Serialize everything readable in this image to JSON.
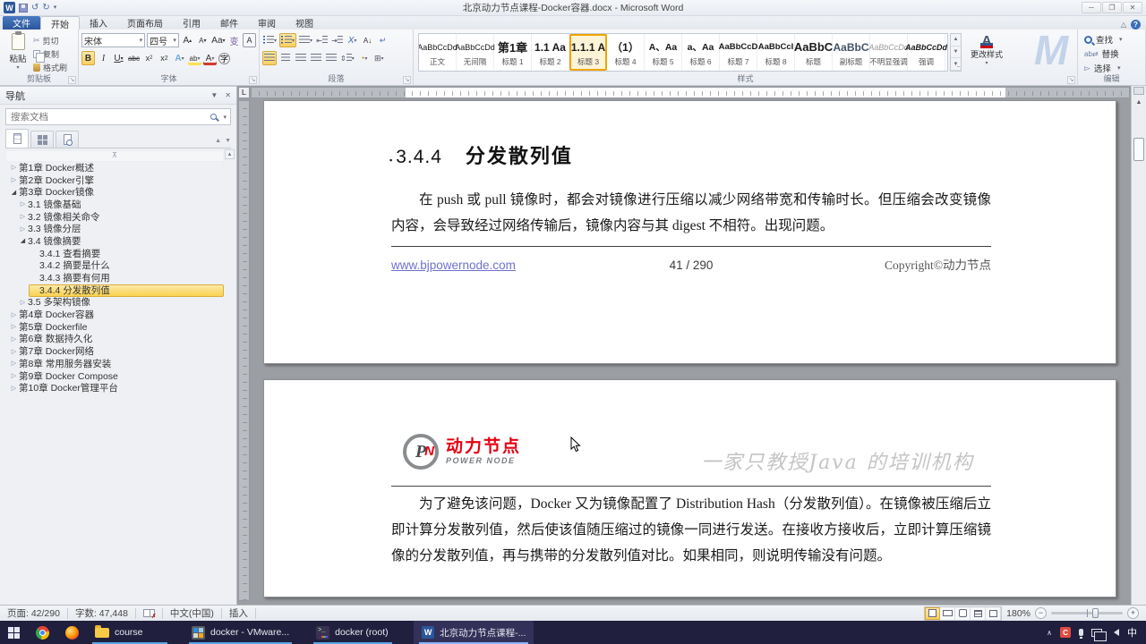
{
  "window": {
    "title": "北京动力节点课程-Docker容器.docx - Microsoft Word"
  },
  "ribbon": {
    "tabs": [
      {
        "label": "文件"
      },
      {
        "label": "开始"
      },
      {
        "label": "插入"
      },
      {
        "label": "页面布局"
      },
      {
        "label": "引用"
      },
      {
        "label": "邮件"
      },
      {
        "label": "审阅"
      },
      {
        "label": "视图"
      }
    ],
    "clipboard": {
      "label": "剪贴板",
      "paste": "粘贴",
      "cut": "剪切",
      "copy": "复制",
      "format_painter": "格式刷"
    },
    "font": {
      "label": "字体",
      "family": "宋体",
      "size": "四号"
    },
    "paragraph": {
      "label": "段落"
    },
    "styles": {
      "label": "样式",
      "change": "更改样式",
      "items": [
        {
          "preview": "AaBbCcDd",
          "name": "正文"
        },
        {
          "preview": "AaBbCcDd",
          "name": "无间隔"
        },
        {
          "preview": "第1章",
          "name": "标题 1"
        },
        {
          "preview": "1.1 Aa",
          "name": "标题 2"
        },
        {
          "preview": "1.1.1 A",
          "name": "标题 3"
        },
        {
          "preview": "（1）",
          "name": "标题 4"
        },
        {
          "preview": "A、Aa",
          "name": "标题 5"
        },
        {
          "preview": "a、Aa",
          "name": "标题 6"
        },
        {
          "preview": "AaBbCcD",
          "name": "标题 7"
        },
        {
          "preview": "AaBbCcI",
          "name": "标题 8"
        },
        {
          "preview": "AaBbC",
          "name": "标题"
        },
        {
          "preview": "AaBbC",
          "name": "副标题"
        },
        {
          "preview": "AaBbCcDd",
          "name": "不明显强调"
        },
        {
          "preview": "AaBbCcDd",
          "name": "强调"
        }
      ]
    },
    "editing": {
      "label": "编辑",
      "find": "查找",
      "replace": "替换",
      "select": "选择"
    }
  },
  "nav": {
    "title": "导航",
    "search_placeholder": "搜索文档",
    "items": [
      {
        "label": "第1章 Docker概述"
      },
      {
        "label": "第2章 Docker引擎"
      },
      {
        "label": "第3章 Docker镜像"
      },
      {
        "label": "3.1 镜像基础"
      },
      {
        "label": "3.2 镜像相关命令"
      },
      {
        "label": "3.3 镜像分层"
      },
      {
        "label": "3.4 镜像摘要"
      },
      {
        "label": "3.4.1 查看摘要"
      },
      {
        "label": "3.4.2 摘要是什么"
      },
      {
        "label": "3.4.3 摘要有何用"
      },
      {
        "label": "3.4.4 分发散列值"
      },
      {
        "label": "3.5 多架构镜像"
      },
      {
        "label": "第4章 Docker容器"
      },
      {
        "label": "第5章 Dockerfile"
      },
      {
        "label": "第6章 数据持久化"
      },
      {
        "label": "第7章 Docker网络"
      },
      {
        "label": "第8章 常用服务器安装"
      },
      {
        "label": "第9章 Docker Compose"
      },
      {
        "label": "第10章 Docker管理平台"
      }
    ]
  },
  "doc": {
    "page1": {
      "heading_number": "3.4.4",
      "heading_text": "分发散列值",
      "body": "在 push 或 pull 镜像时，都会对镜像进行压缩以减少网络带宽和传输时长。但压缩会改变镜像内容，会导致经过网络传输后，镜像内容与其 digest 不相符。出现问题。",
      "footer": {
        "url": "www.bjpowernode.com",
        "page": "41 / 290",
        "copyright": "Copyright©动力节点"
      }
    },
    "page2": {
      "logo": {
        "p": "P",
        "n": "N",
        "brand": "动力节点",
        "sub": "POWER NODE"
      },
      "slogan": "一家只教授Java 的培训机构",
      "body": "为了避免该问题，Docker 又为镜像配置了 Distribution Hash（分发散列值）。在镜像被压缩后立即计算分发散列值，然后使该值随压缩过的镜像一同进行发送。在接收方接收后，立即计算压缩镜像的分发散列值，再与携带的分发散列值对比。如果相同，则说明传输没有问题。"
    }
  },
  "status": {
    "page": "页面: 42/290",
    "words": "字数: 47,448",
    "language": "中文(中国)",
    "insert_mode": "插入",
    "zoom": "180%"
  },
  "taskbar": {
    "items": [
      {
        "label": "course"
      },
      {
        "label": "docker - VMware..."
      },
      {
        "label": "docker (root)"
      },
      {
        "label": "北京动力节点课程-..."
      }
    ],
    "tray_ime": "中"
  }
}
